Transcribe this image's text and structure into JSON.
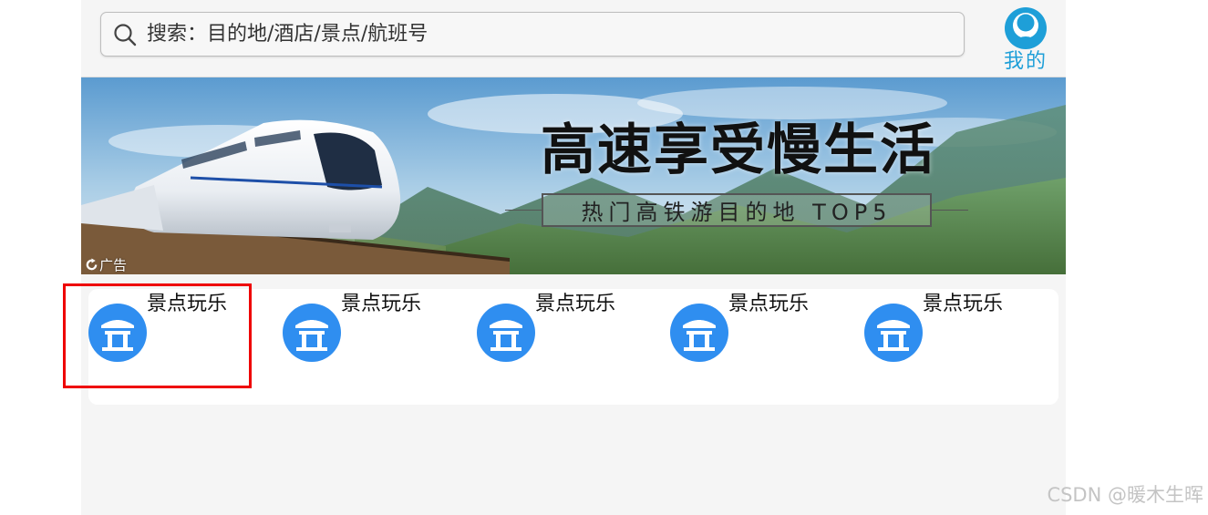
{
  "search": {
    "placeholder": "搜索：目的地/酒店/景点/航班号",
    "icon": "search-icon"
  },
  "profile": {
    "label": "我的",
    "icon": "avatar-icon"
  },
  "banner": {
    "title": "高速享受慢生活",
    "subtitle": "热门高铁游目的地 TOP5",
    "ad_label": "广告"
  },
  "categories": [
    {
      "label": "景点玩乐",
      "icon": "gate-icon"
    },
    {
      "label": "景点玩乐",
      "icon": "gate-icon"
    },
    {
      "label": "景点玩乐",
      "icon": "gate-icon"
    },
    {
      "label": "景点玩乐",
      "icon": "gate-icon"
    },
    {
      "label": "景点玩乐",
      "icon": "gate-icon"
    }
  ],
  "watermark": "CSDN @暖木生晖",
  "colors": {
    "accent": "#1e9fd8",
    "icon_blue": "#2f8ef0",
    "highlight": "#ee0000"
  }
}
